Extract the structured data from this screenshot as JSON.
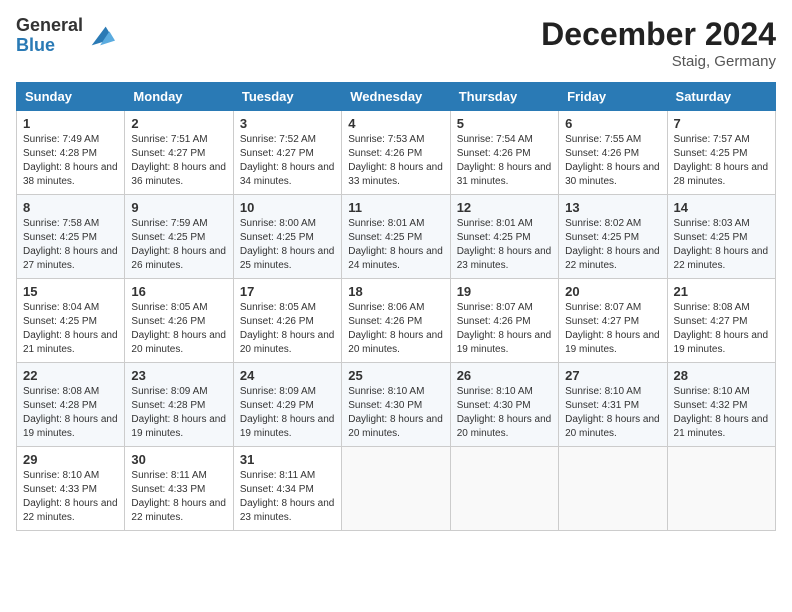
{
  "header": {
    "logo_general": "General",
    "logo_blue": "Blue",
    "title": "December 2024",
    "subtitle": "Staig, Germany"
  },
  "days_of_week": [
    "Sunday",
    "Monday",
    "Tuesday",
    "Wednesday",
    "Thursday",
    "Friday",
    "Saturday"
  ],
  "weeks": [
    [
      {
        "day": "1",
        "sunrise": "7:49 AM",
        "sunset": "4:28 PM",
        "daylight": "8 hours and 38 minutes."
      },
      {
        "day": "2",
        "sunrise": "7:51 AM",
        "sunset": "4:27 PM",
        "daylight": "8 hours and 36 minutes."
      },
      {
        "day": "3",
        "sunrise": "7:52 AM",
        "sunset": "4:27 PM",
        "daylight": "8 hours and 34 minutes."
      },
      {
        "day": "4",
        "sunrise": "7:53 AM",
        "sunset": "4:26 PM",
        "daylight": "8 hours and 33 minutes."
      },
      {
        "day": "5",
        "sunrise": "7:54 AM",
        "sunset": "4:26 PM",
        "daylight": "8 hours and 31 minutes."
      },
      {
        "day": "6",
        "sunrise": "7:55 AM",
        "sunset": "4:26 PM",
        "daylight": "8 hours and 30 minutes."
      },
      {
        "day": "7",
        "sunrise": "7:57 AM",
        "sunset": "4:25 PM",
        "daylight": "8 hours and 28 minutes."
      }
    ],
    [
      {
        "day": "8",
        "sunrise": "7:58 AM",
        "sunset": "4:25 PM",
        "daylight": "8 hours and 27 minutes."
      },
      {
        "day": "9",
        "sunrise": "7:59 AM",
        "sunset": "4:25 PM",
        "daylight": "8 hours and 26 minutes."
      },
      {
        "day": "10",
        "sunrise": "8:00 AM",
        "sunset": "4:25 PM",
        "daylight": "8 hours and 25 minutes."
      },
      {
        "day": "11",
        "sunrise": "8:01 AM",
        "sunset": "4:25 PM",
        "daylight": "8 hours and 24 minutes."
      },
      {
        "day": "12",
        "sunrise": "8:01 AM",
        "sunset": "4:25 PM",
        "daylight": "8 hours and 23 minutes."
      },
      {
        "day": "13",
        "sunrise": "8:02 AM",
        "sunset": "4:25 PM",
        "daylight": "8 hours and 22 minutes."
      },
      {
        "day": "14",
        "sunrise": "8:03 AM",
        "sunset": "4:25 PM",
        "daylight": "8 hours and 22 minutes."
      }
    ],
    [
      {
        "day": "15",
        "sunrise": "8:04 AM",
        "sunset": "4:25 PM",
        "daylight": "8 hours and 21 minutes."
      },
      {
        "day": "16",
        "sunrise": "8:05 AM",
        "sunset": "4:26 PM",
        "daylight": "8 hours and 20 minutes."
      },
      {
        "day": "17",
        "sunrise": "8:05 AM",
        "sunset": "4:26 PM",
        "daylight": "8 hours and 20 minutes."
      },
      {
        "day": "18",
        "sunrise": "8:06 AM",
        "sunset": "4:26 PM",
        "daylight": "8 hours and 20 minutes."
      },
      {
        "day": "19",
        "sunrise": "8:07 AM",
        "sunset": "4:26 PM",
        "daylight": "8 hours and 19 minutes."
      },
      {
        "day": "20",
        "sunrise": "8:07 AM",
        "sunset": "4:27 PM",
        "daylight": "8 hours and 19 minutes."
      },
      {
        "day": "21",
        "sunrise": "8:08 AM",
        "sunset": "4:27 PM",
        "daylight": "8 hours and 19 minutes."
      }
    ],
    [
      {
        "day": "22",
        "sunrise": "8:08 AM",
        "sunset": "4:28 PM",
        "daylight": "8 hours and 19 minutes."
      },
      {
        "day": "23",
        "sunrise": "8:09 AM",
        "sunset": "4:28 PM",
        "daylight": "8 hours and 19 minutes."
      },
      {
        "day": "24",
        "sunrise": "8:09 AM",
        "sunset": "4:29 PM",
        "daylight": "8 hours and 19 minutes."
      },
      {
        "day": "25",
        "sunrise": "8:10 AM",
        "sunset": "4:30 PM",
        "daylight": "8 hours and 20 minutes."
      },
      {
        "day": "26",
        "sunrise": "8:10 AM",
        "sunset": "4:30 PM",
        "daylight": "8 hours and 20 minutes."
      },
      {
        "day": "27",
        "sunrise": "8:10 AM",
        "sunset": "4:31 PM",
        "daylight": "8 hours and 20 minutes."
      },
      {
        "day": "28",
        "sunrise": "8:10 AM",
        "sunset": "4:32 PM",
        "daylight": "8 hours and 21 minutes."
      }
    ],
    [
      {
        "day": "29",
        "sunrise": "8:10 AM",
        "sunset": "4:33 PM",
        "daylight": "8 hours and 22 minutes."
      },
      {
        "day": "30",
        "sunrise": "8:11 AM",
        "sunset": "4:33 PM",
        "daylight": "8 hours and 22 minutes."
      },
      {
        "day": "31",
        "sunrise": "8:11 AM",
        "sunset": "4:34 PM",
        "daylight": "8 hours and 23 minutes."
      },
      null,
      null,
      null,
      null
    ]
  ]
}
